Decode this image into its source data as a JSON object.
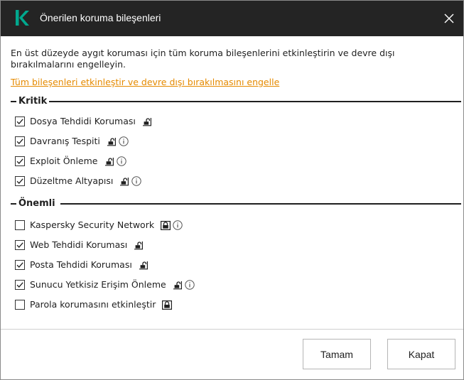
{
  "dialog": {
    "title": "Önerilen koruma bileşenleri",
    "description": "En üst düzeyde aygıt koruması için tüm koruma bileşenlerini etkinleştirin ve devre dışı bırakılmalarını engelleyin.",
    "enable_all_link": "Tüm bileşenleri etkinleştir ve devre dışı bırakılmasını engelle"
  },
  "sections": {
    "critical": {
      "label": "Kritik",
      "items": [
        {
          "label": "Dosya Tehdidi Koruması",
          "checked": true,
          "lock": "unlocked",
          "info": false
        },
        {
          "label": "Davranış Tespiti",
          "checked": true,
          "lock": "unlocked",
          "info": true
        },
        {
          "label": "Exploit Önleme",
          "checked": true,
          "lock": "unlocked",
          "info": true
        },
        {
          "label": "Düzeltme Altyapısı",
          "checked": true,
          "lock": "unlocked",
          "info": true
        }
      ]
    },
    "important": {
      "label": "Önemli",
      "items": [
        {
          "label": "Kaspersky Security Network",
          "checked": false,
          "lock": "locked",
          "info": true
        },
        {
          "label": "Web Tehdidi Koruması",
          "checked": true,
          "lock": "unlocked",
          "info": false
        },
        {
          "label": "Posta Tehdidi Koruması",
          "checked": true,
          "lock": "unlocked",
          "info": false
        },
        {
          "label": "Sunucu Yetkisiz Erişim Önleme",
          "checked": true,
          "lock": "unlocked",
          "info": true
        },
        {
          "label": "Parola korumasını etkinleştir",
          "checked": false,
          "lock": "locked",
          "info": false
        }
      ]
    }
  },
  "footer": {
    "ok_label": "Tamam",
    "close_label": "Kapat"
  },
  "colors": {
    "titlebar": "#242424",
    "logo": "#00a88e",
    "link": "#e58a00"
  },
  "icons": {
    "logo": "kaspersky-logo-icon",
    "close": "close-icon",
    "lock_open": "unlocked-icon",
    "lock_closed": "locked-icon",
    "info": "info-icon",
    "check": "checkmark-icon"
  }
}
